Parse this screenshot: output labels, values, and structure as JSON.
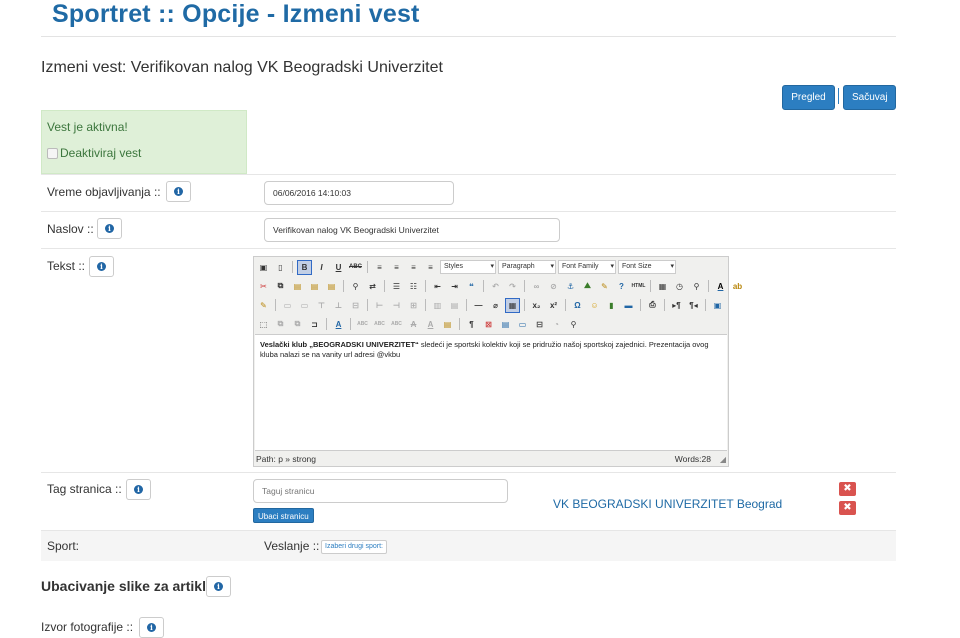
{
  "page": {
    "title": "Sportret :: Opcije - Izmeni vest",
    "subtitle": "Izmeni vest: Verifikovan nalog VK Beogradski Univerzitet"
  },
  "actions": {
    "preview_label": "Pregled",
    "save_label": "Sačuvaj"
  },
  "status": {
    "active_text": "Vest je aktivna!",
    "deactivate_label": "Deaktiviraj vest"
  },
  "form": {
    "publish_time": {
      "label": "Vreme objavljivanja ::",
      "value": "06/06/2016  14:10:03"
    },
    "title": {
      "label": "Naslov ::",
      "value": "Verifikovan nalog VK Beogradski Univerzitet"
    },
    "text": {
      "label": "Tekst ::"
    },
    "tag_page": {
      "label": "Tag stranica ::",
      "placeholder": "Taguj stranicu",
      "insert_button": "Ubaci stranicu",
      "tagged_page": "VK BEOGRADSKI UNIVERZITET Beograd"
    },
    "sport": {
      "label": "Sport:",
      "value": "Veslanje ::",
      "change_button": "Izaberi drugi sport:"
    },
    "image_section": {
      "label": "Ubacivanje slike za artikl ::"
    },
    "photo_source": {
      "label": "Izvor fotografije ::"
    }
  },
  "editor": {
    "styles_select": "Styles",
    "format_select": "Paragraph",
    "font_family_select": "Font Family",
    "font_size_select": "Font Size",
    "content_bold": "Veslački klub „BEOGRADSKI UNIVERZITET“",
    "content_rest": " sledeći je sportski kolektiv koji se pridružio našoj sportskoj zajednici. Prezentacija ovog kluba nalazi se na vanity url adresi @vkbu",
    "path": "Path: p » strong",
    "words": "Words:28"
  },
  "icons": {
    "info": "i",
    "remove": "✖"
  },
  "colors": {
    "brand": "#1f6aa5",
    "primary_button": "#2c7ec1",
    "success_bg": "#dff0d8",
    "success_text": "#3c763d",
    "danger": "#d9534f"
  }
}
